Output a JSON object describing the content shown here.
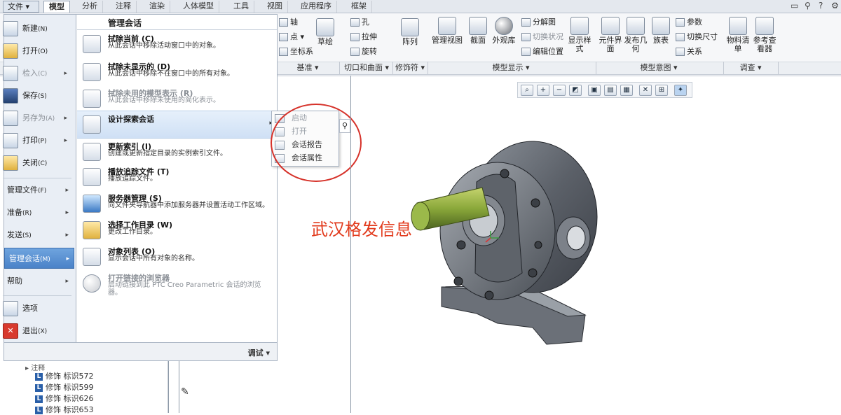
{
  "tabbar": {
    "file_label": "文件",
    "tabs": [
      "模型",
      "分析",
      "注释",
      "渲染",
      "人体模型",
      "工具",
      "视图",
      "应用程序",
      "框架"
    ],
    "active_tab": "模型"
  },
  "ribbon": {
    "datum_items": [
      "轴",
      "点",
      "坐标系"
    ],
    "sketch_label": "草绘",
    "cut_items": [
      "孔",
      "拉伸",
      "旋转"
    ],
    "pattern_label": "阵列",
    "display_buttons": [
      "管理视图",
      "截面",
      "外观库",
      "显示样式"
    ],
    "display_small": [
      "分解图",
      "切换状况",
      "编辑位置"
    ],
    "intent_buttons": [
      "元件界面",
      "发布几何",
      "族表"
    ],
    "intent_small": [
      "参数",
      "切换尺寸",
      "关系"
    ],
    "investigate_buttons": [
      "物料清单",
      "参考查看器"
    ],
    "groups": [
      "基准",
      "切口和曲面",
      "修饰符",
      "模型显示",
      "模型意图",
      "调查"
    ]
  },
  "file_menu": {
    "items": [
      {
        "label": "新建",
        "key": "(N)",
        "disabled": false
      },
      {
        "label": "打开",
        "key": "(O)",
        "disabled": false
      },
      {
        "label": "检入",
        "key": "(C)",
        "disabled": true
      },
      {
        "label": "保存",
        "key": "(S)",
        "disabled": false
      },
      {
        "label": "另存为",
        "key": "(A)",
        "disabled": true
      },
      {
        "label": "打印",
        "key": "(P)",
        "disabled": false
      },
      {
        "label": "关闭",
        "key": "(C)",
        "disabled": false
      }
    ],
    "items2": [
      {
        "label": "管理文件",
        "key": "(F)"
      },
      {
        "label": "准备",
        "key": "(R)"
      },
      {
        "label": "发送",
        "key": "(S)"
      },
      {
        "label": "管理会话",
        "key": "(M)"
      },
      {
        "label": "帮助",
        "key": ""
      }
    ],
    "options_label": "选项",
    "exit_label": "退出",
    "exit_key": "(X)",
    "section_title": "管理会话",
    "entries": [
      {
        "title": "拭除当前 (C)",
        "desc": "从此会话中移除活动窗口中的对象。",
        "disabled": false
      },
      {
        "title": "拭除未显示的 (D)",
        "desc": "从此会话中移除不在窗口中的所有对象。",
        "disabled": false
      },
      {
        "title": "拭除未用的模型表示 (R)",
        "desc": "从此会话中移除未使用的简化表示。",
        "disabled": true
      },
      {
        "title": "设计探索会话",
        "desc": "",
        "disabled": false
      },
      {
        "title": "更新索引 (I)",
        "desc": "创建或更新指定目录的实例索引文件。",
        "disabled": false
      },
      {
        "title": "播放追踪文件 (T)",
        "desc": "播放追踪文件。",
        "disabled": false
      },
      {
        "title": "服务器管理 (S)",
        "desc": "向文件夹导航器中添加服务器并设置活动工作区域。",
        "disabled": false
      },
      {
        "title": "选择工作目录 (W)",
        "desc": "更改工作目录。",
        "disabled": false
      },
      {
        "title": "对象列表 (O)",
        "desc": "显示会话中所有对象的名称。",
        "disabled": false
      },
      {
        "title": "打开链接的浏览器",
        "desc": "启动链接到此 PTC Creo Parametric 会话的浏览器。",
        "disabled": true
      }
    ],
    "footer_label": "调试"
  },
  "submenu": {
    "items": [
      {
        "label": "启动",
        "disabled": true
      },
      {
        "label": "打开",
        "disabled": true
      },
      {
        "label": "会话报告",
        "disabled": false
      },
      {
        "label": "会话属性",
        "disabled": false
      }
    ]
  },
  "tree": {
    "items": [
      "修饰 标识572",
      "修饰 标识599",
      "修饰 标识626",
      "修饰 标识653"
    ],
    "partial_label": "注释"
  },
  "watermark": "武汉格发信息",
  "colors": {
    "accent": "#4a82c8",
    "annotation_red": "#d6322a",
    "shaft_green": "#8aa83a"
  }
}
